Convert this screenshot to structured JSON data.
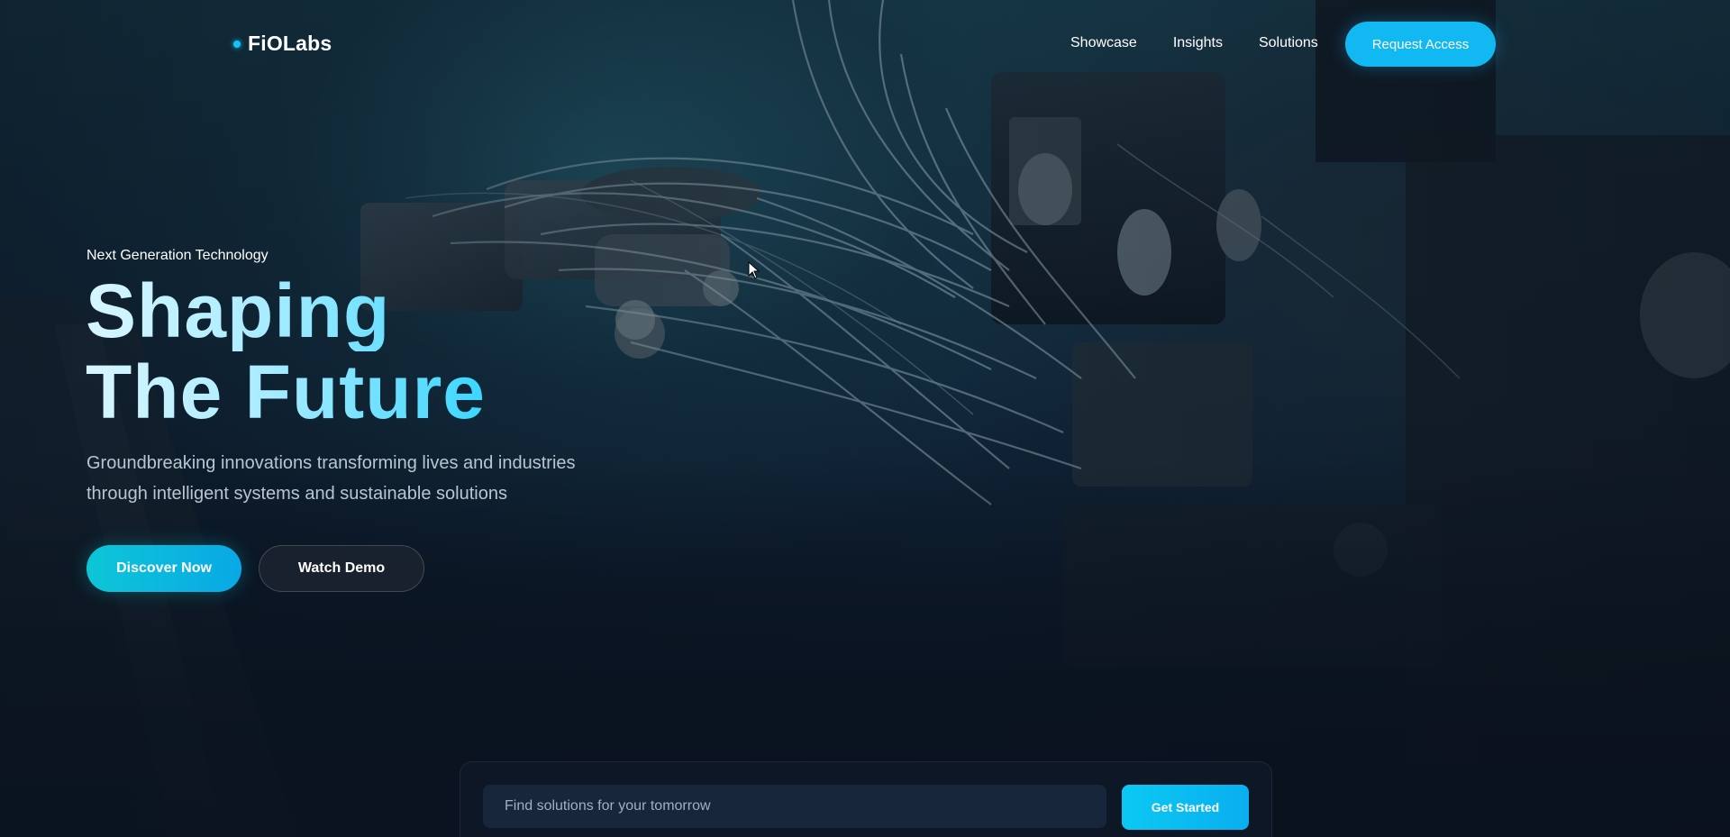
{
  "brand": {
    "name": "FiOLabs",
    "accent_color": "#12c4f0"
  },
  "nav": {
    "links": [
      {
        "label": "Showcase"
      },
      {
        "label": "Insights"
      },
      {
        "label": "Solutions"
      }
    ],
    "cta_label": "Request Access"
  },
  "hero": {
    "eyebrow": "Next Generation Technology",
    "headline_line1": "Shaping",
    "headline_line2": "The Future",
    "subtext": "Groundbreaking innovations transforming lives and industries through intelligent systems and sustainable solutions",
    "primary_button": "Discover Now",
    "secondary_button": "Watch Demo",
    "background_image": "robot-arm-machinery"
  },
  "search": {
    "placeholder": "Find solutions for your tomorrow",
    "value": "",
    "button_label": "Get Started"
  },
  "colors": {
    "primary_button": "#0cc6d6",
    "cta_button": "#12b8f2",
    "background": "#0b1624"
  }
}
